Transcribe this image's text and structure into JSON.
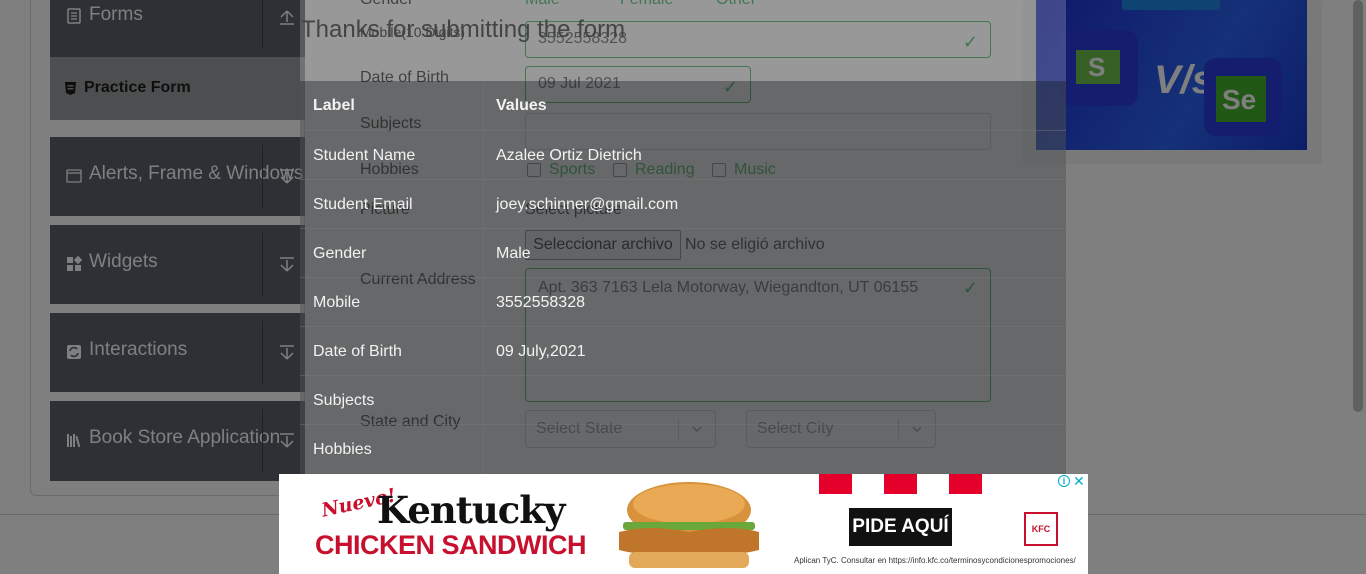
{
  "sidebar": {
    "groups": [
      {
        "label": "Forms"
      },
      {
        "label": "Alerts, Frame & Windows"
      },
      {
        "label": "Widgets"
      },
      {
        "label": "Interactions"
      },
      {
        "label": "Book Store Application"
      }
    ],
    "active_item": {
      "label": "Practice Form"
    }
  },
  "form": {
    "gender_label": "Gender",
    "gender_options": [
      "Male",
      "Female",
      "Other"
    ],
    "mobile_label": "Mobile(10 Digits)",
    "mobile_value": "3552558328",
    "dob_label": "Date of Birth",
    "dob_value": "09 Jul 2021",
    "subjects_label": "Subjects",
    "hobbies_label": "Hobbies",
    "hobbies": [
      "Sports",
      "Reading",
      "Music"
    ],
    "picture_label": "Picture",
    "select_picture_label": "Select picture",
    "file_button": "Seleccionar archivo",
    "file_status": "No se eligió archivo",
    "address_label": "Current Address",
    "address_value": "Apt. 363 7163 Lela Motorway, Wiegandton, UT 06155",
    "state_city_label": "State and City",
    "state_placeholder": "Select State",
    "city_placeholder": "Select City"
  },
  "modal": {
    "title": "Thanks for submitting the form",
    "headers": {
      "label": "Label",
      "value": "Values"
    },
    "rows": [
      {
        "label": "Student Name",
        "value": "Azalee Ortiz Dietrich"
      },
      {
        "label": "Student Email",
        "value": "joey.schinner@gmail.com"
      },
      {
        "label": "Gender",
        "value": "Male"
      },
      {
        "label": "Mobile",
        "value": "3552558328"
      },
      {
        "label": "Date of Birth",
        "value": "09 July,2021"
      },
      {
        "label": "Subjects",
        "value": ""
      },
      {
        "label": "Hobbies",
        "value": ""
      }
    ]
  },
  "ad": {
    "nuevo": "Nuevo!",
    "headline": "Kentucky",
    "subheadline": "CHICKEN SANDWICH",
    "cta": "PIDE AQUÍ",
    "brand": "KFC",
    "fine_print": "Aplican TyC. Consultar en https://info.kfc.co/terminosycondicionespromociones/"
  },
  "colors": {
    "sidebar_group": "#5a616b",
    "active_item": "#999c9f",
    "valid_green": "#28a745",
    "kfc_red": "#c8102e",
    "banner_blue": "#2b63f0"
  },
  "icons": [
    "forms-icon",
    "practice-form-icon",
    "alerts-icon",
    "widgets-icon",
    "interactions-icon",
    "book-store-icon",
    "chevron-up-icon",
    "chevron-down-icon",
    "checkmark-icon",
    "ad-info-icon",
    "close-icon"
  ]
}
